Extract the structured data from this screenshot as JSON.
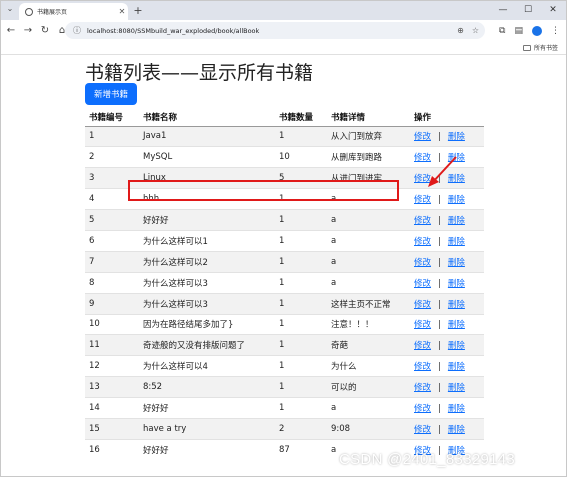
{
  "browser": {
    "tab_title": "书籍展示页",
    "url": "localhost:8080/SSMbuild_war_exploded/book/allBook",
    "bookmark_folder": "所有书签",
    "window_controls": [
      "—",
      "☐",
      "✕"
    ]
  },
  "page": {
    "title": "书籍列表——显示所有书籍",
    "add_button": "新增书籍",
    "headers": [
      "书籍编号",
      "书籍名称",
      "书籍数量",
      "书籍详情",
      "操作"
    ],
    "edit_label": "修改",
    "separator": "|",
    "delete_label": "删除",
    "rows": [
      {
        "id": "1",
        "name": "Java1",
        "count": "1",
        "detail": "从入门到放弃"
      },
      {
        "id": "2",
        "name": "MySQL",
        "count": "10",
        "detail": "从删库到跑路"
      },
      {
        "id": "3",
        "name": "Linux",
        "count": "5",
        "detail": "从进门到进牢"
      },
      {
        "id": "4",
        "name": "hhh",
        "count": "1",
        "detail": "a"
      },
      {
        "id": "5",
        "name": "好好好",
        "count": "1",
        "detail": "a"
      },
      {
        "id": "6",
        "name": "为什么这样可以1",
        "count": "1",
        "detail": "a"
      },
      {
        "id": "7",
        "name": "为什么这样可以2",
        "count": "1",
        "detail": "a"
      },
      {
        "id": "8",
        "name": "为什么这样可以3",
        "count": "1",
        "detail": "a"
      },
      {
        "id": "9",
        "name": "为什么这样可以3",
        "count": "1",
        "detail": "这样主页不正常"
      },
      {
        "id": "10",
        "name": "因为在路径结尾多加了}",
        "count": "1",
        "detail": "注意！！！"
      },
      {
        "id": "11",
        "name": "奇迹般的又没有排版问题了",
        "count": "1",
        "detail": "奇葩"
      },
      {
        "id": "12",
        "name": "为什么这样可以4",
        "count": "1",
        "detail": "为什么"
      },
      {
        "id": "13",
        "name": "8:52",
        "count": "1",
        "detail": "可以的"
      },
      {
        "id": "14",
        "name": "好好好",
        "count": "1",
        "detail": "a"
      },
      {
        "id": "15",
        "name": "have a try",
        "count": "2",
        "detail": "9:08"
      },
      {
        "id": "16",
        "name": "好好好",
        "count": "87",
        "detail": "a"
      }
    ]
  },
  "watermark": "CSDN @2401_83329143",
  "colors": {
    "primary_button": "#0d6efd",
    "link": "#0d6efd",
    "highlight": "#e01919"
  }
}
